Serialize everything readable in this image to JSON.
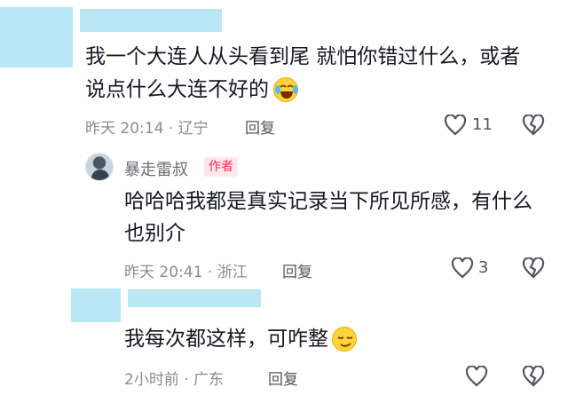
{
  "comments": [
    {
      "text_line1": "我一个大连人从头看到尾  就怕你错过什么，或者",
      "text_line2": "说点什么大连不好的",
      "emoji": "laughing-crying-emoji",
      "time": "昨天 20:14 · 辽宁",
      "reply_label": "回复",
      "likes": "11"
    },
    {
      "author": "暴走雷叔",
      "author_tag": "作者",
      "text_line1": "哈哈哈我都是真实记录当下所见所感，有什么",
      "text_line2": "也别介",
      "time": "昨天 20:41 · 浙江",
      "reply_label": "回复",
      "likes": "3"
    },
    {
      "text_line1": "我每次都这样，可咋整",
      "emoji": "smirk-emoji",
      "time": "2小时前 · 广东",
      "reply_label": "回复"
    }
  ],
  "colors": {
    "redaction": "#b9e8f4",
    "author_tag": "#fe2c55",
    "meta": "#8a8b91"
  },
  "icons": [
    "heart-icon",
    "broken-heart-icon"
  ]
}
